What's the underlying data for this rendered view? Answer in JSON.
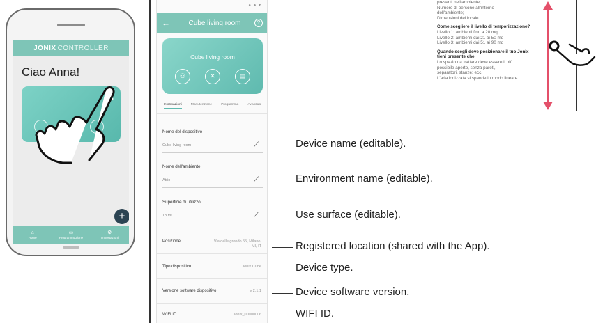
{
  "phone": {
    "brand_jonix": "JONIX",
    "brand_controller": " CONTROLLER",
    "greeting": "Ciao Anna!",
    "fab_label": "+",
    "nav": [
      {
        "icon": "⌂",
        "label": "Home"
      },
      {
        "icon": "▭",
        "label": "Programmazione"
      },
      {
        "icon": "⚙",
        "label": "Impostazioni"
      }
    ]
  },
  "detail": {
    "title": "Cube living room",
    "back_icon": "←",
    "help_icon": "?",
    "card_title": "Cube living room",
    "tabs": [
      "Informazioni",
      "Manutenzione",
      "Programma",
      "Avanzate"
    ],
    "fields": [
      {
        "label": "Nome del dispositivo",
        "value": "Cube living room"
      },
      {
        "label": "Nome dell'ambiente",
        "value": "Atrio"
      },
      {
        "label": "Superficie di utilizzo",
        "value": "18 m²"
      }
    ],
    "rows": [
      {
        "label": "Posizione",
        "value": "Via delle grondo 55, Milano, MI, IT"
      },
      {
        "label": "Tipo dispositivo",
        "value": "Jonix Cube"
      },
      {
        "label": "Versione software dispositivo",
        "value": "v 2.1.1"
      },
      {
        "label": "WIFI ID",
        "value": "Jonix_00000006"
      }
    ]
  },
  "callouts": [
    "Device name (editable).",
    "Environment name (editable).",
    "Use surface (editable).",
    "Registered location (shared with the App).",
    "Device type.",
    "Device software version.",
    "WIFI ID."
  ],
  "help_panel": {
    "lines_top": [
      "presenti nell'ambiente;",
      "Numero di persone all'interno",
      "dell'ambiente;",
      "Dimensioni del locale."
    ],
    "heading1": "Come scegliere il livello di temporizzazione?",
    "lines_mid": [
      "Livello 1: ambienti fino a 20 mq",
      "Livello 2: ambienti dai 21 ai 50 mq",
      "Livello 3: ambienti dai 51 ai 90 mq"
    ],
    "heading2": "Quando scegli dove posizionare il tuo Jonix tieni presente che:",
    "lines_bottom": [
      "Lo spazio da trattare deve essere il più",
      "possibile aperto, senza pareti,",
      "separatori, stanze; ecc.",
      "L'aria ionizzata si spande in modo lineare"
    ]
  },
  "colors": {
    "accent": "#7ec5b7",
    "fab": "#2c4453",
    "arrow": "#e4506a"
  }
}
